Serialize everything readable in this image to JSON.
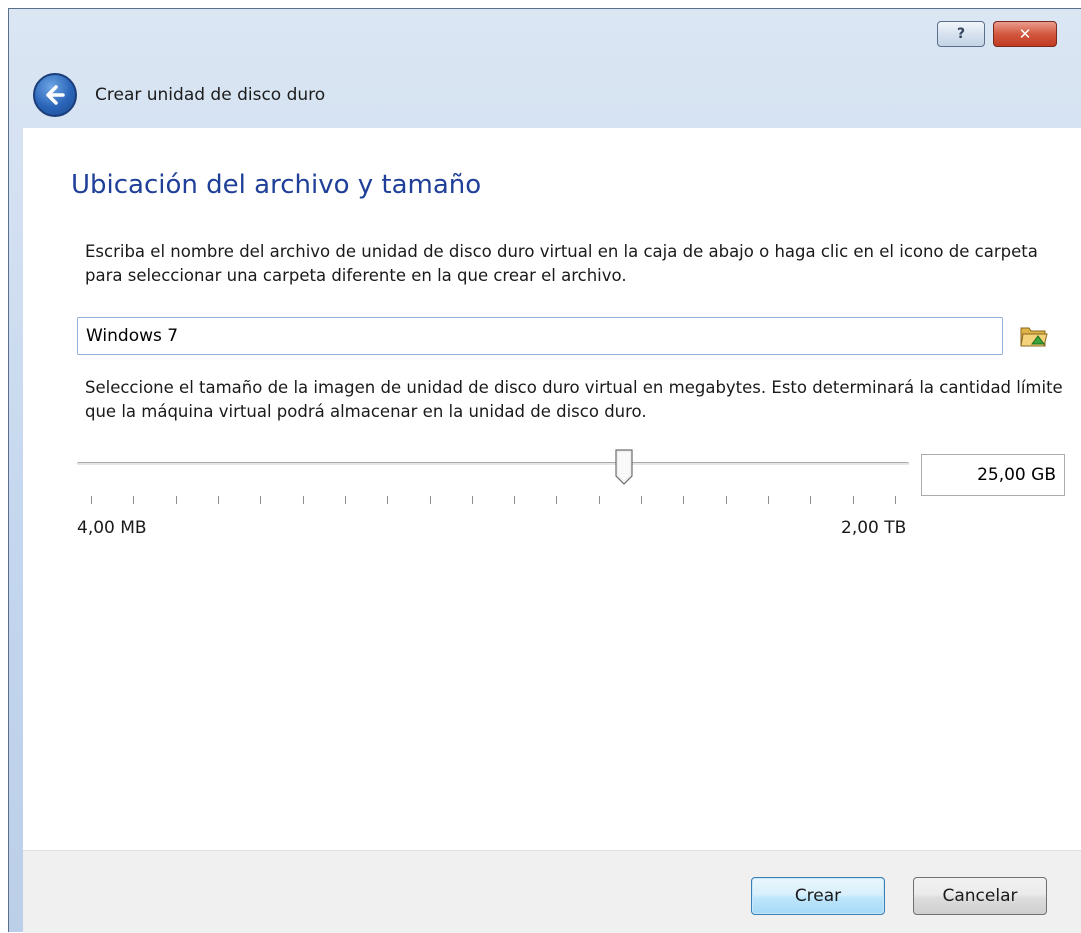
{
  "titlebar": {
    "title": "Crear unidad de disco duro",
    "help_label": "?",
    "close_label": "✕",
    "back_icon": "back-arrow-icon"
  },
  "page": {
    "heading": "Ubicación del archivo y tamaño",
    "file_instructions": "Escriba el nombre del archivo de unidad de disco duro virtual en la caja de abajo o haga clic en el icono de carpeta para seleccionar una carpeta diferente en la que crear el archivo.",
    "filename_value": "Windows 7",
    "folder_icon": "folder-icon",
    "size_instructions": "Seleccione el tamaño de la imagen de unidad de disco duro virtual en megabytes. Esto determinará la cantidad límite que la máquina virtual podrá almacenar en la unidad de disco duro.",
    "size_value": "25,00 GB",
    "size_slider_fraction": 0.657,
    "min_label": "4,00 MB",
    "max_label": "2,00 TB"
  },
  "footer": {
    "create_label": "Crear",
    "cancel_label": "Cancelar"
  },
  "colors": {
    "heading": "#1f3f99",
    "titlebar": "#c3d6ee",
    "field_border": "#8fb2d9"
  }
}
